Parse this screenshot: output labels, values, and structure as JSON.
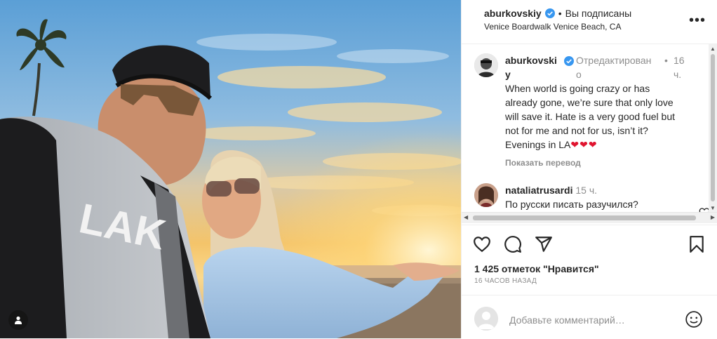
{
  "header": {
    "username": "aburkovskiy",
    "separator": "•",
    "following_status": "Вы подписаны",
    "location": "Venice Boardwalk Venice Beach, CA",
    "more_icon": "more-horizontal-icon"
  },
  "caption": {
    "username_line1": "aburkovski",
    "username_line2": "y",
    "edited_line1": "Отредактирован",
    "edited_line2": "о",
    "separator": "•",
    "time_line1": "16",
    "time_line2": "ч.",
    "text_lines": [
      "When world is going crazy or has",
      "already gone, we’re sure that only love",
      "will save it. Hate is a very good fuel but",
      "not for me and not for us, isn’t it?"
    ],
    "last_line": "Evenings in LA",
    "hearts": "❤❤❤",
    "translate": "Показать перевод"
  },
  "comment": {
    "username": "nataliatrusardi",
    "time": "15 ч.",
    "text": "По русски писать разучился?"
  },
  "actions": {
    "likes": "1 425 отметок \"Нравится\"",
    "timestamp": "16 ЧАСОВ НАЗАД"
  },
  "add_comment": {
    "placeholder": "Добавьте комментарий…"
  },
  "colors": {
    "verified": "#3897f0",
    "heart": "#e0142f",
    "meta_text": "#8e8e8e"
  }
}
